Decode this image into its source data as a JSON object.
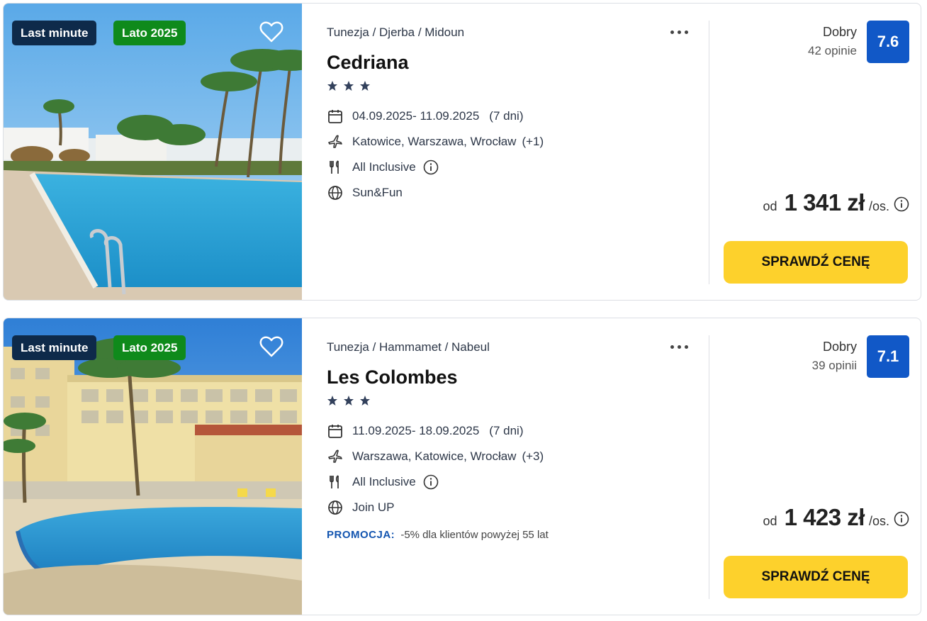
{
  "colors": {
    "rating_box": "#1158c7",
    "cta": "#fdd12c",
    "badge_last_minute": "#0e2a4a",
    "badge_season": "#0f8a1b",
    "promo": "#1355b0"
  },
  "offers": [
    {
      "badges": [
        "Last minute",
        "Lato 2025"
      ],
      "destination": "Tunezja / Djerba / Midoun",
      "name": "Cedriana",
      "stars": 3,
      "dates": "04.09.2025- 11.09.2025",
      "duration": "(7 dni)",
      "departures": "Katowice, Warszawa, Wrocław",
      "departures_more": "(+1)",
      "board": "All Inclusive",
      "concept": "Sun&Fun",
      "rating_label": "Dobry",
      "rating_count": "42 opinie",
      "rating_score": "7.6",
      "price_prefix": "od",
      "price": "1 341 zł",
      "price_suffix": "/os.",
      "cta": "SPRAWDŹ CENĘ"
    },
    {
      "badges": [
        "Last minute",
        "Lato 2025"
      ],
      "destination": "Tunezja / Hammamet / Nabeul",
      "name": "Les Colombes",
      "stars": 3,
      "dates": "11.09.2025- 18.09.2025",
      "duration": "(7 dni)",
      "departures": "Warszawa, Katowice, Wrocław",
      "departures_more": "(+3)",
      "board": "All Inclusive",
      "concept": "Join UP",
      "promo_label": "PROMOCJA:",
      "promo_text": "-5% dla klientów powyżej 55 lat",
      "rating_label": "Dobry",
      "rating_count": "39 opinii",
      "rating_score": "7.1",
      "price_prefix": "od",
      "price": "1 423 zł",
      "price_suffix": "/os.",
      "cta": "SPRAWDŹ CENĘ"
    }
  ]
}
